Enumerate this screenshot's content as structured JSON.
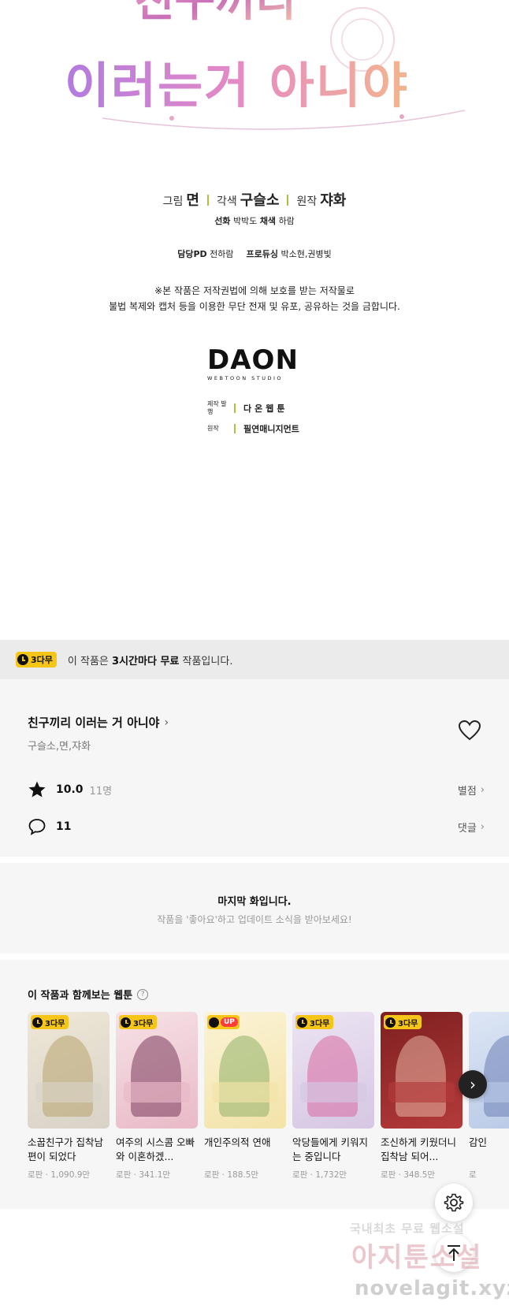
{
  "panel": {
    "logo_title_line1": "친구끼리",
    "logo_title_line2": "이러는거 아니야",
    "credits": [
      {
        "key": "그림",
        "value": "면"
      },
      {
        "key": "각색",
        "value": "구슬소"
      },
      {
        "key": "원작",
        "value": "쟈화"
      }
    ],
    "line2": {
      "k1": "선화",
      "v1": "박박도",
      "k2": "채색",
      "v2": "하람"
    },
    "line3": {
      "k1": "담당PD",
      "v1": "전하람",
      "k2": "프로듀싱",
      "v2": "박소현,권병빛"
    },
    "notice1": "※본 작품은 저작권법에 의해 보호를 받는 저작물로",
    "notice2": "불법 복제와 캡처 등을 이용한 무단 전재 및 유포, 공유하는 것을 금합니다.",
    "studio_name": "DAON",
    "studio_sub": "WEBTOON STUDIO",
    "pub": [
      {
        "key": "제작 발행",
        "value": "다온웹툰"
      },
      {
        "key": "원작",
        "value": "필연매니지먼트"
      }
    ]
  },
  "free_banner": {
    "badge": "3다무",
    "text_pre": "이 작품은",
    "text_bold": "3시간마다 무료",
    "text_post": "작품입니다."
  },
  "info": {
    "title": "친구끼리 이러는 거 아니야",
    "authors": "구슬소,면,쟈화",
    "rating": "10.0",
    "rating_count": "11명",
    "rating_link": "별점",
    "comments": "11",
    "comments_link": "댓글",
    "icons": {
      "favorite": "heart-outline-icon",
      "rating": "star-filled-icon",
      "comments": "speech-bubble-icon"
    }
  },
  "last": {
    "title": "마지막 화입니다.",
    "sub": "작품을 '좋아요'하고 업데이트 소식을 받아보세요!"
  },
  "reco": {
    "heading": "이 작품과 함께보는 웹툰",
    "help": "?",
    "items": [
      {
        "badge": "3다무",
        "up": "",
        "name": "소꿉친구가 집착남편이 되었다",
        "genre": "로판",
        "views": "1,090.9만",
        "c1": "#d8d2c8",
        "c2": "#b8a46e",
        "c3": "#efe7d6"
      },
      {
        "badge": "3다무",
        "up": "",
        "name": "여주의 시스콤 오빠와 이혼하겠...",
        "genre": "로판",
        "views": "341.1만",
        "c1": "#e9b9c7",
        "c2": "#7a3c5c",
        "c3": "#f6e2e6"
      },
      {
        "badge": "",
        "up": "UP",
        "name": "개인주의적 연애",
        "genre": "로판",
        "views": "188.5만",
        "c1": "#f3e3a8",
        "c2": "#8fb06a",
        "c3": "#fbf3d6"
      },
      {
        "badge": "3다무",
        "up": "",
        "name": "악당들에게 키워지는 중입니다",
        "genre": "로판",
        "views": "1,732만",
        "c1": "#d6c6e3",
        "c2": "#d86aa0",
        "c3": "#ece4f3"
      },
      {
        "badge": "3다무",
        "up": "",
        "name": "조신하게 키웠더니 집착남 되어...",
        "genre": "로판",
        "views": "348.5만",
        "c1": "#b43a3a",
        "c2": "#e7b4a4",
        "c3": "#7e2020"
      },
      {
        "badge": "",
        "up": "",
        "name": "감인",
        "genre": "로",
        "views": "",
        "c1": "#b7c8e6",
        "c2": "#6e7fb4",
        "c3": "#dde6f5"
      }
    ],
    "next": "›"
  },
  "fabs": {
    "settings": "gear-icon",
    "top": "arrow-up-to-top-icon"
  },
  "watermark": {
    "line1": "국내최초 무료 웹소설",
    "line2": "아지툰소설",
    "line3": "novelagit.xyz"
  }
}
